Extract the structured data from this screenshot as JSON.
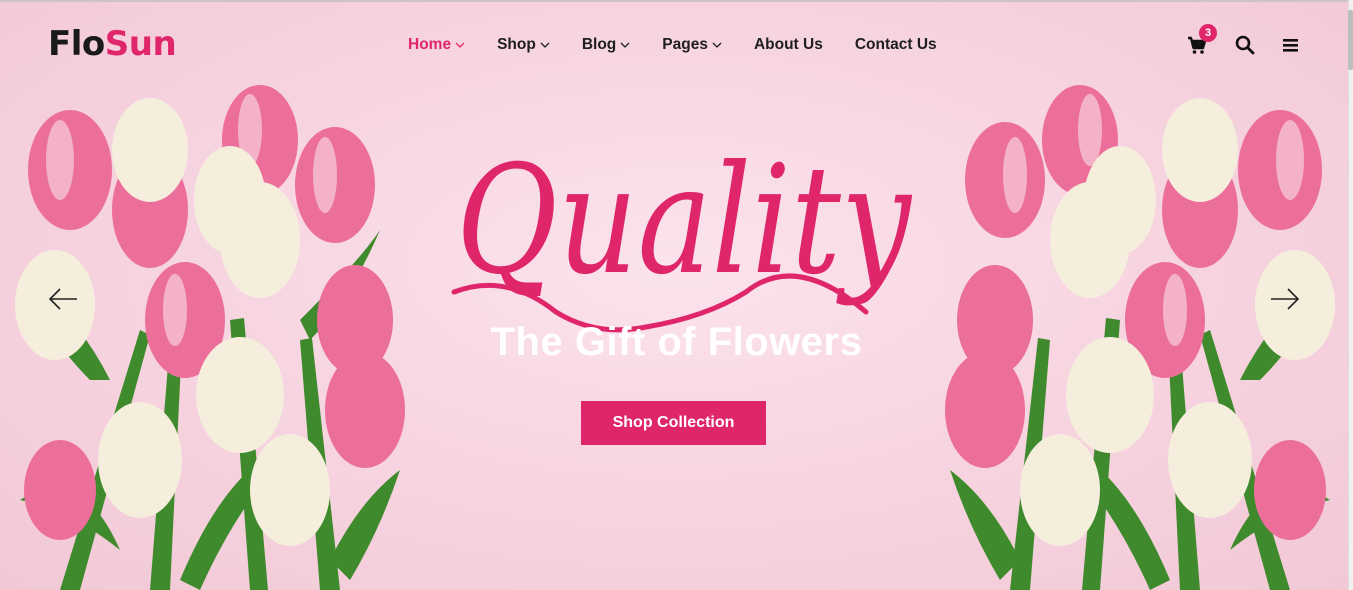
{
  "brand": {
    "part1": "Flo",
    "part2": "Sun"
  },
  "nav": {
    "items": [
      {
        "label": "Home",
        "has_dropdown": true,
        "active": true
      },
      {
        "label": "Shop",
        "has_dropdown": true,
        "active": false
      },
      {
        "label": "Blog",
        "has_dropdown": true,
        "active": false
      },
      {
        "label": "Pages",
        "has_dropdown": true,
        "active": false
      },
      {
        "label": "About Us",
        "has_dropdown": false,
        "active": false
      },
      {
        "label": "Contact Us",
        "has_dropdown": false,
        "active": false
      }
    ]
  },
  "header_icons": {
    "cart_icon": "shopping-cart-icon",
    "cart_count": "3",
    "search_icon": "search-icon",
    "menu_icon": "hamburger-menu-icon"
  },
  "hero": {
    "script_heading": "Quality",
    "subtitle": "The Gift of Flowers",
    "cta_label": "Shop Collection",
    "prev_icon": "arrow-left-icon",
    "next_icon": "arrow-right-icon"
  },
  "colors": {
    "accent": "#e0266a",
    "background": "#f7d6e1",
    "text": "#1e1e1e"
  }
}
